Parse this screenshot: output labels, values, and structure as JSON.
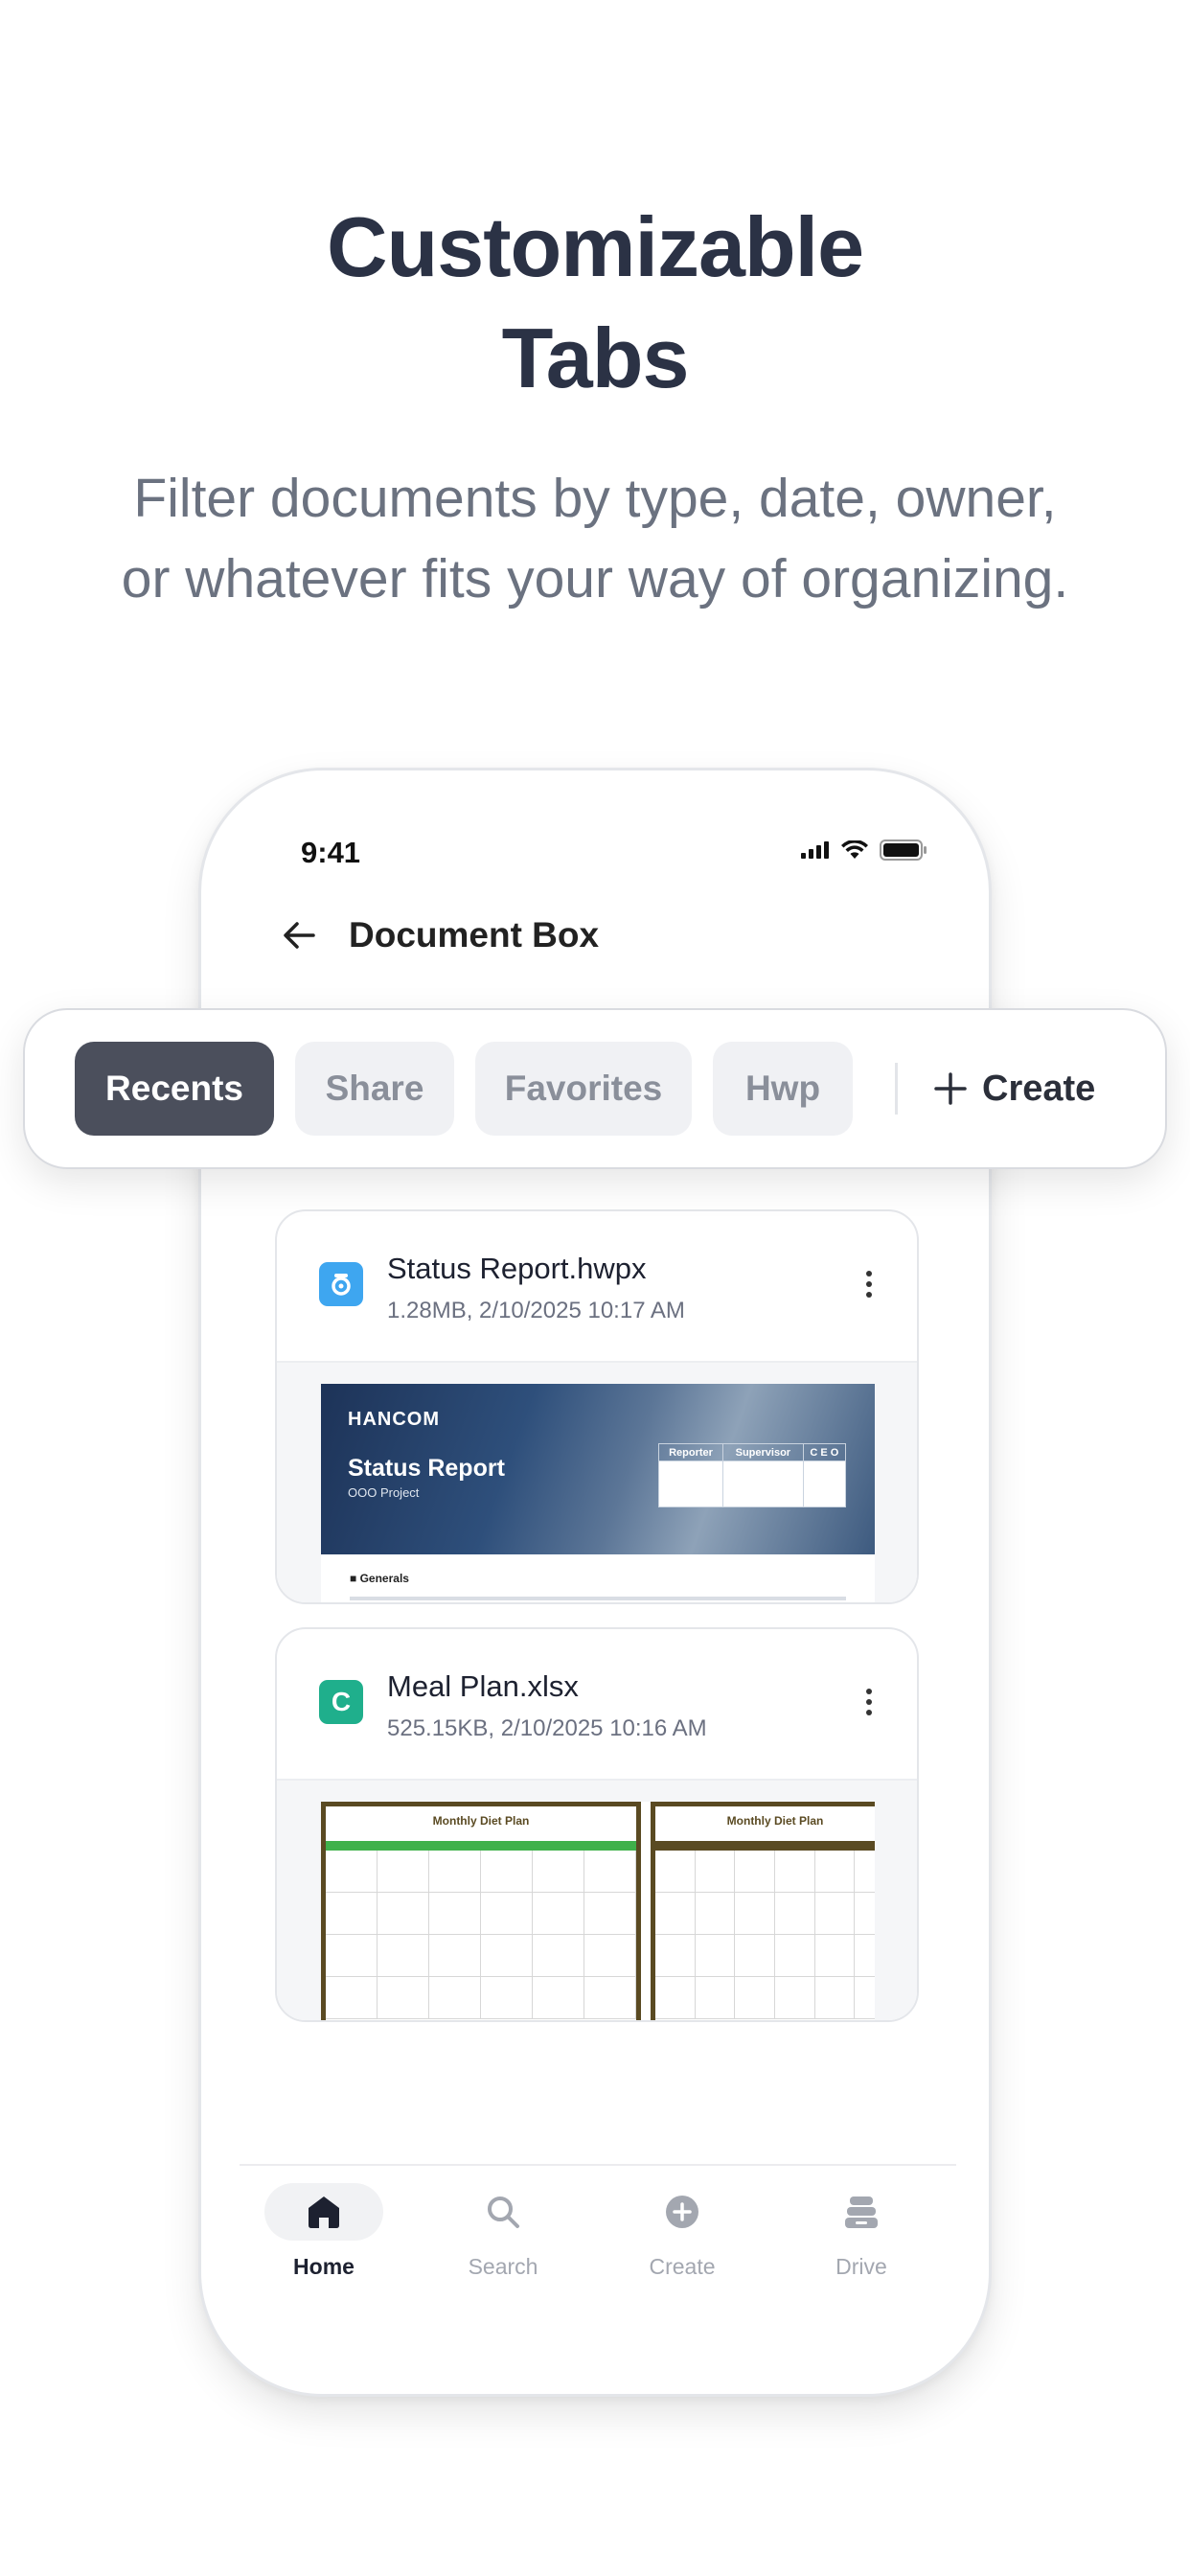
{
  "headline": {
    "line1": "Customizable",
    "line2": "Tabs"
  },
  "subheadline": {
    "line1": "Filter documents by type, date, owner,",
    "line2": "or whatever fits your way of organizing."
  },
  "status_bar": {
    "time": "9:41"
  },
  "header": {
    "title": "Document Box"
  },
  "tabs": [
    {
      "label": "Recents",
      "active": true
    },
    {
      "label": "Share",
      "active": false
    },
    {
      "label": "Favorites",
      "active": false
    },
    {
      "label": "Hwp",
      "active": false
    }
  ],
  "create_label": "Create",
  "files": [
    {
      "name": "Status Report.hwpx",
      "meta": "1.28MB, 2/10/2025 10:17 AM",
      "icon": "hwp-icon",
      "icon_color": "#3ea6f0",
      "preview": {
        "logo": "HANCOM",
        "title": "Status  Report",
        "subtitle": "ООО  Project",
        "table_headers": [
          "Reporter",
          "Supervisor",
          "C E O"
        ],
        "section": "■  Generals"
      }
    },
    {
      "name": "Meal Plan.xlsx",
      "meta": "525.15KB, 2/10/2025 10:16 AM",
      "icon": "cell-icon",
      "icon_letter": "C",
      "icon_color": "#1faf8c",
      "preview": {
        "sheet1_title": "Monthly Diet Plan",
        "sheet2_title": "Monthly Diet Plan"
      }
    }
  ],
  "bottom_nav": [
    {
      "label": "Home",
      "icon": "home-icon",
      "active": true
    },
    {
      "label": "Search",
      "icon": "search-icon",
      "active": false
    },
    {
      "label": "Create",
      "icon": "plus-circle-icon",
      "active": false
    },
    {
      "label": "Drive",
      "icon": "drive-icon",
      "active": false
    }
  ],
  "colors": {
    "headline": "#2b3245",
    "subheadline": "#6b7280",
    "tab_active_bg": "#4b4f5c",
    "tab_inactive_bg": "#f0f1f4",
    "nav_active": "#1d2130",
    "nav_inactive": "#a3a7b0"
  }
}
